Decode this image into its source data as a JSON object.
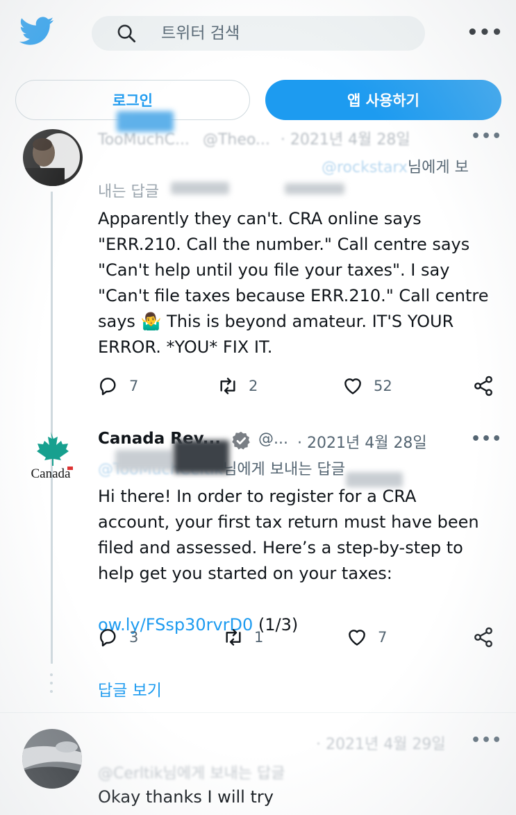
{
  "header": {
    "search_placeholder": "트위터 검색",
    "more_label": "•••"
  },
  "buttons": {
    "login": "로그인",
    "use_app": "앱 사용하기"
  },
  "tweets": [
    {
      "author_partial": "TooMuchC...",
      "handle_partial": "@Theo...",
      "date": "· 2021년 4월 28일",
      "reply_to_handle": "@rockstarx",
      "reply_to_suffix": "님에게 보",
      "reply_to_line2": "내는 답글",
      "text": "Apparently they can't.  CRA online says\n\"ERR.210.  Call the number.\"  Call centre says\n\"Can't help until you file your taxes\".   I say\n\"Can't file taxes because ERR.210.\" Call centre\nsays 🤷‍♂️  This is beyond amateur.  IT'S YOUR\nERROR.  *YOU* FIX IT.",
      "replies": "7",
      "retweets": "2",
      "likes": "52"
    },
    {
      "author": "Canada Rev...",
      "handle": "@...",
      "date": "· 2021년 4월 28일",
      "avatar_text": "Canada",
      "reply_to_handle": "@TooMuchCeltik",
      "reply_to_suffix": "님에게 보내는 답글",
      "text": "Hi there! In order to register for a CRA\naccount, your first tax return must have been\nfiled and assessed. Here’s a step-by-step to\nhelp get you started on your taxes:",
      "link": "ow.ly/FSsp30rvrD0",
      "link_suffix": " (1/3)",
      "replies": "3",
      "retweets": "1",
      "likes": "7"
    },
    {
      "date_partial": "· 2021년 4월 29일",
      "reply_to_line": "@Cerltik님에게 보내는 답글",
      "text": "Okay thanks I will try"
    }
  ],
  "show_replies": "답글 보기",
  "colors": {
    "accent": "#1d9bf0",
    "text": "#0f1419",
    "muted": "#536471",
    "maple": "#2aa198"
  }
}
